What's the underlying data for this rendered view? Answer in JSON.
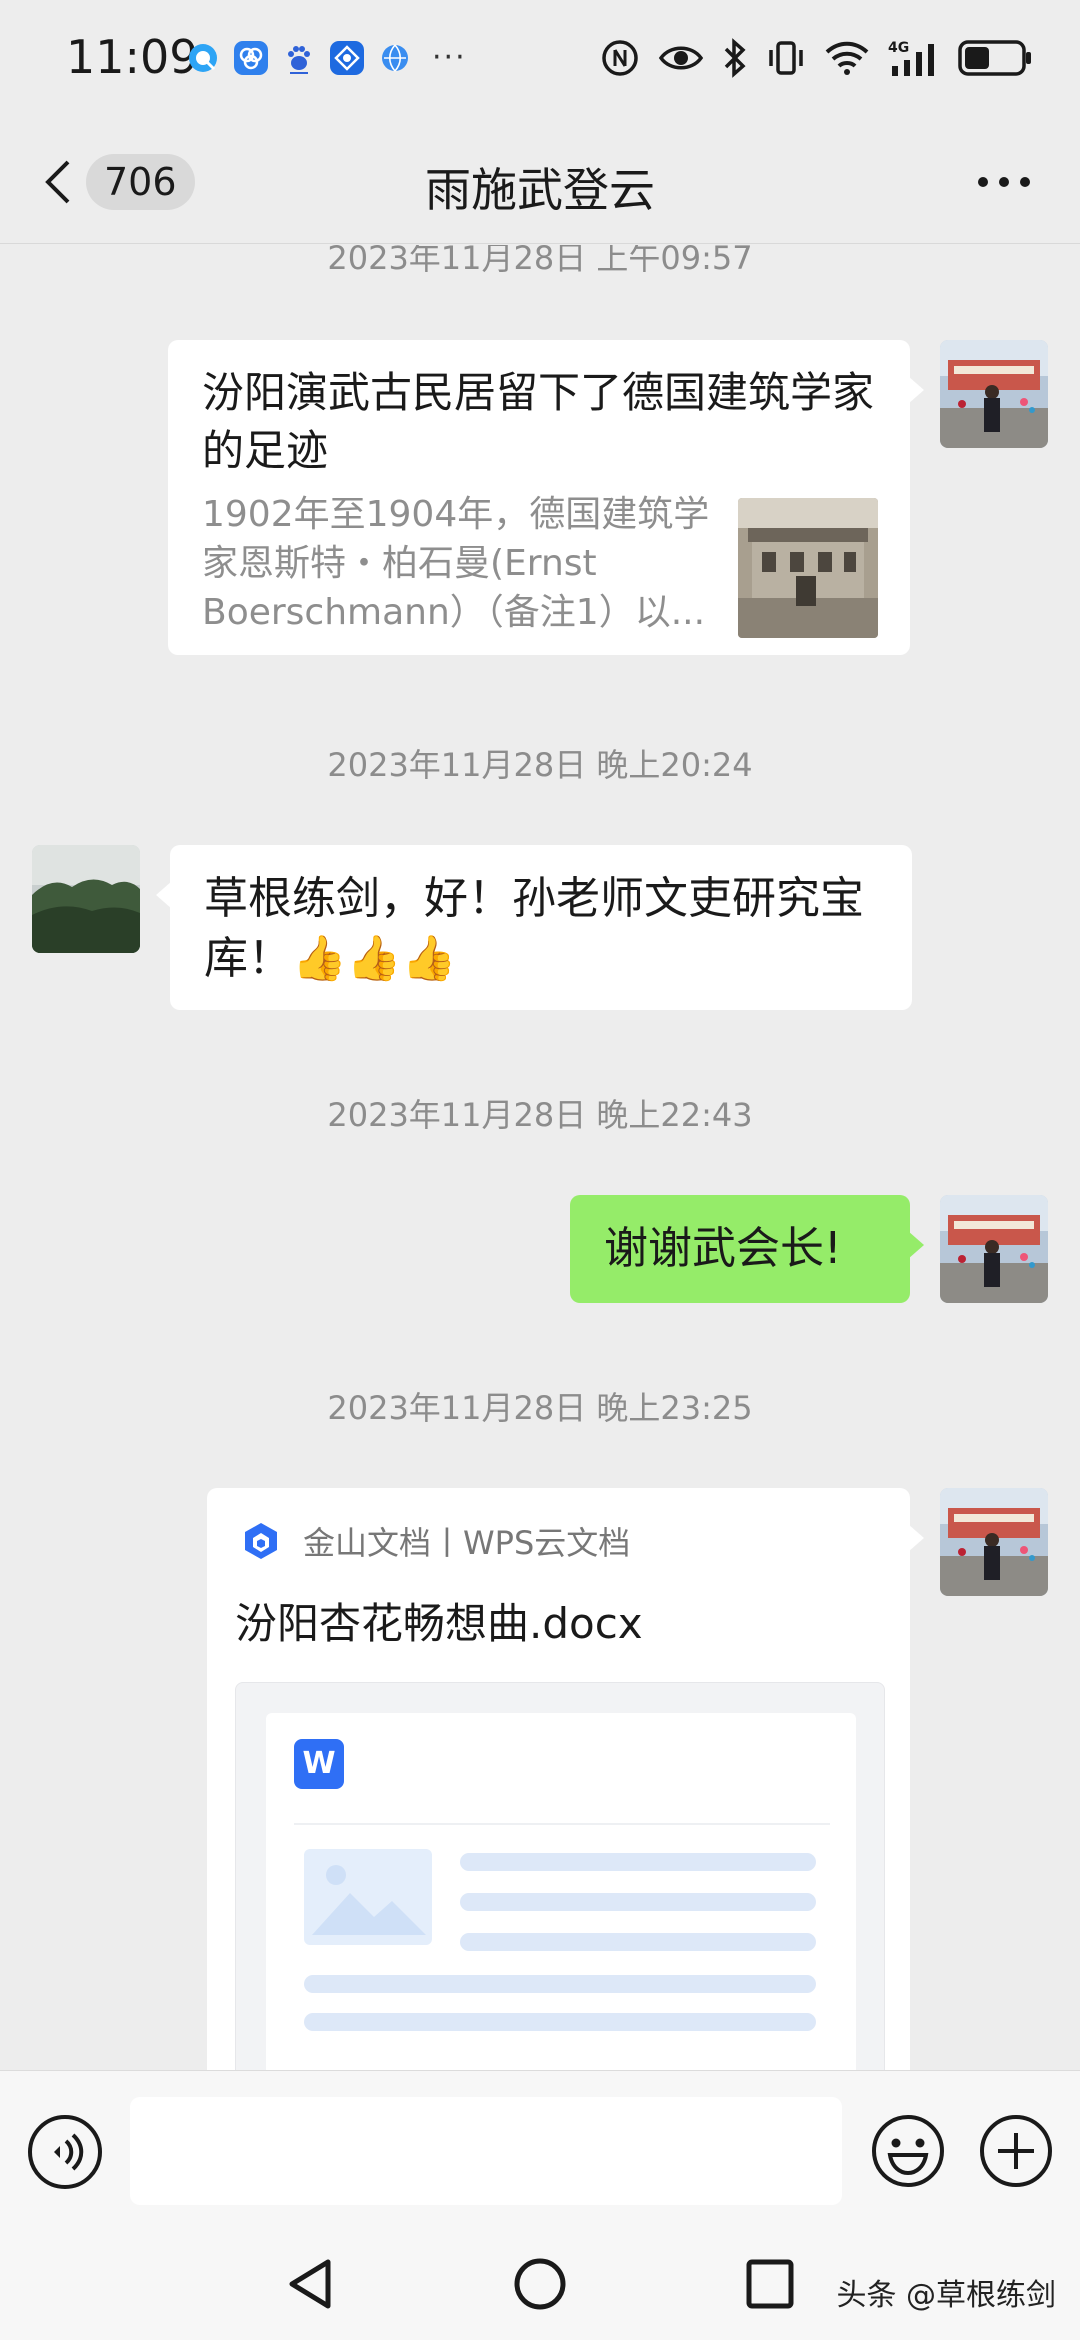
{
  "status_bar": {
    "time": "11:09",
    "notification_icons": [
      "qq-browser-icon",
      "photos-icon",
      "baidu-icon",
      "mail-icon",
      "browser-icon",
      "more-dots-icon"
    ],
    "system_icons": [
      "nfc-icon",
      "eye-comfort-icon",
      "bluetooth-icon",
      "vibrate-icon",
      "wifi-icon",
      "signal-4g-icon",
      "battery-icon"
    ],
    "network": "4G",
    "battery_level": 0.45
  },
  "header": {
    "unread_count": "706",
    "title": "雨施武登云"
  },
  "messages": [
    {
      "timestamp": "2023年11月28日 上午09:57",
      "side": "right",
      "type": "link",
      "title": "汾阳演武古民居留下了德国建筑学家的足迹",
      "description": "1902年至1904年，德国建筑学家恩斯特・柏石曼(Ernst Boerschmann）（备注1）以..."
    },
    {
      "timestamp": "2023年11月28日 晚上20:24",
      "side": "left",
      "type": "text",
      "text": "草根练剑，好！孙老师文吏研究宝库！👍👍👍"
    },
    {
      "timestamp": "2023年11月28日 晚上22:43",
      "side": "right",
      "type": "text",
      "text": "谢谢武会长!"
    },
    {
      "timestamp": "2023年11月28日 晚上23:25",
      "side": "right",
      "type": "file",
      "source": "金山文档丨WPS云文档",
      "file_name": "汾阳杏花畅想曲.docx",
      "file_app_letter": "W"
    }
  ],
  "input_bar": {
    "placeholder": ""
  },
  "watermark": "头条 @草根练剑",
  "colors": {
    "background": "#ededed",
    "bubble_green": "#95ec69",
    "bubble_white": "#ffffff",
    "wps_blue": "#2f6ff5"
  }
}
